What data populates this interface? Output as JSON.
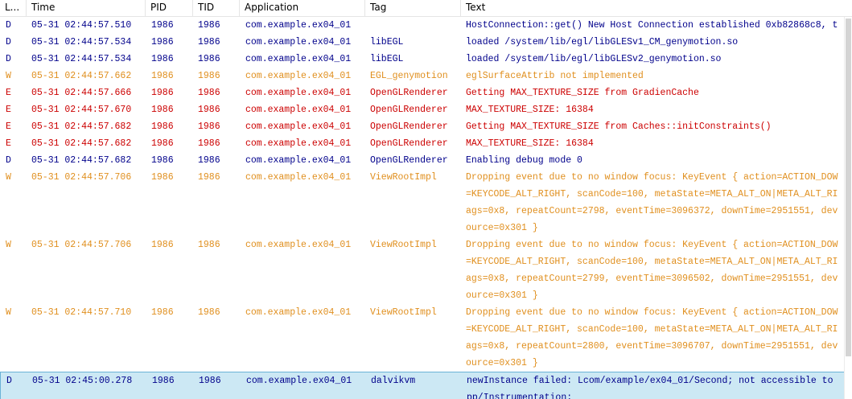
{
  "columns": [
    {
      "key": "level",
      "label": "L..."
    },
    {
      "key": "time",
      "label": "Time"
    },
    {
      "key": "pid",
      "label": "PID"
    },
    {
      "key": "tid",
      "label": "TID"
    },
    {
      "key": "app",
      "label": "Application"
    },
    {
      "key": "tag",
      "label": "Tag"
    },
    {
      "key": "text",
      "label": "Text"
    }
  ],
  "colors": {
    "D": "#00008b",
    "W": "#e08f1e",
    "E": "#cc0000",
    "selected_bg": "#cce8f4",
    "selected_border": "#6ab2d6"
  },
  "rows": [
    {
      "level": "D",
      "time": "05-31 02:44:57.510",
      "pid": "1986",
      "tid": "1986",
      "app": "com.example.ex04_01",
      "tag": "",
      "text": [
        "HostConnection::get() New Host Connection established 0xb82868c8, t"
      ]
    },
    {
      "level": "D",
      "time": "05-31 02:44:57.534",
      "pid": "1986",
      "tid": "1986",
      "app": "com.example.ex04_01",
      "tag": "libEGL",
      "text": [
        "loaded /system/lib/egl/libGLESv1_CM_genymotion.so"
      ]
    },
    {
      "level": "D",
      "time": "05-31 02:44:57.534",
      "pid": "1986",
      "tid": "1986",
      "app": "com.example.ex04_01",
      "tag": "libEGL",
      "text": [
        "loaded /system/lib/egl/libGLESv2_genymotion.so"
      ]
    },
    {
      "level": "W",
      "time": "05-31 02:44:57.662",
      "pid": "1986",
      "tid": "1986",
      "app": "com.example.ex04_01",
      "tag": "EGL_genymotion",
      "text": [
        "eglSurfaceAttrib not implemented"
      ]
    },
    {
      "level": "E",
      "time": "05-31 02:44:57.666",
      "pid": "1986",
      "tid": "1986",
      "app": "com.example.ex04_01",
      "tag": "OpenGLRenderer",
      "text": [
        "Getting MAX_TEXTURE_SIZE from GradienCache"
      ]
    },
    {
      "level": "E",
      "time": "05-31 02:44:57.670",
      "pid": "1986",
      "tid": "1986",
      "app": "com.example.ex04_01",
      "tag": "OpenGLRenderer",
      "text": [
        "MAX_TEXTURE_SIZE: 16384"
      ]
    },
    {
      "level": "E",
      "time": "05-31 02:44:57.682",
      "pid": "1986",
      "tid": "1986",
      "app": "com.example.ex04_01",
      "tag": "OpenGLRenderer",
      "text": [
        "Getting MAX_TEXTURE_SIZE from Caches::initConstraints()"
      ]
    },
    {
      "level": "E",
      "time": "05-31 02:44:57.682",
      "pid": "1986",
      "tid": "1986",
      "app": "com.example.ex04_01",
      "tag": "OpenGLRenderer",
      "text": [
        "MAX_TEXTURE_SIZE: 16384"
      ]
    },
    {
      "level": "D",
      "time": "05-31 02:44:57.682",
      "pid": "1986",
      "tid": "1986",
      "app": "com.example.ex04_01",
      "tag": "OpenGLRenderer",
      "text": [
        "Enabling debug mode 0"
      ]
    },
    {
      "level": "W",
      "time": "05-31 02:44:57.706",
      "pid": "1986",
      "tid": "1986",
      "app": "com.example.ex04_01",
      "tag": "ViewRootImpl",
      "text": [
        "Dropping event due to no window focus: KeyEvent { action=ACTION_DOW",
        "=KEYCODE_ALT_RIGHT, scanCode=100, metaState=META_ALT_ON|META_ALT_RI",
        "ags=0x8, repeatCount=2798, eventTime=3096372, downTime=2951551, dev",
        "ource=0x301 }"
      ]
    },
    {
      "level": "W",
      "time": "05-31 02:44:57.706",
      "pid": "1986",
      "tid": "1986",
      "app": "com.example.ex04_01",
      "tag": "ViewRootImpl",
      "text": [
        "Dropping event due to no window focus: KeyEvent { action=ACTION_DOW",
        "=KEYCODE_ALT_RIGHT, scanCode=100, metaState=META_ALT_ON|META_ALT_RI",
        "ags=0x8, repeatCount=2799, eventTime=3096502, downTime=2951551, dev",
        "ource=0x301 }"
      ]
    },
    {
      "level": "W",
      "time": "05-31 02:44:57.710",
      "pid": "1986",
      "tid": "1986",
      "app": "com.example.ex04_01",
      "tag": "ViewRootImpl",
      "text": [
        "Dropping event due to no window focus: KeyEvent { action=ACTION_DOW",
        "=KEYCODE_ALT_RIGHT, scanCode=100, metaState=META_ALT_ON|META_ALT_RI",
        "ags=0x8, repeatCount=2800, eventTime=3096707, downTime=2951551, dev",
        "ource=0x301 }"
      ]
    },
    {
      "level": "D",
      "time": "05-31 02:45:00.278",
      "pid": "1986",
      "tid": "1986",
      "app": "com.example.ex04_01",
      "tag": "dalvikvm",
      "text": [
        "newInstance failed: Lcom/example/ex04_01/Second; not accessible to",
        "pp/Instrumentation;"
      ],
      "selected": true
    }
  ]
}
